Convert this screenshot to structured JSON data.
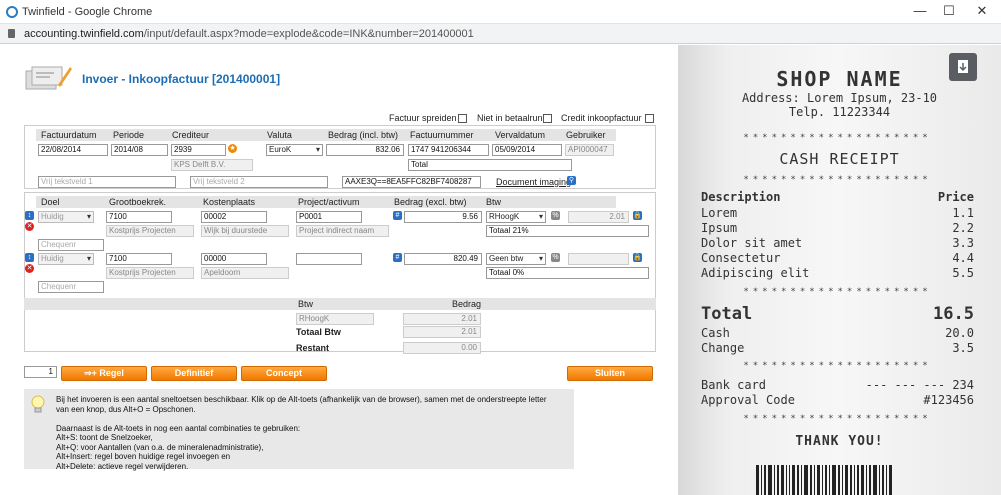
{
  "window": {
    "title": "Twinfield - Google Chrome",
    "url_host": "accounting.twinfield.com",
    "url_path": "/input/default.aspx?mode=explode&code=INK&number=201400001"
  },
  "page": {
    "title": "Invoer - Inkoopfactuur [201400001]"
  },
  "options": {
    "spread": "Factuur spreiden",
    "not_in_payrun": "Niet in betaalrun",
    "credit": "Credit inkoopfactuur"
  },
  "header": {
    "cols": [
      "Factuurdatum",
      "Periode",
      "Crediteur",
      "Valuta",
      "Bedrag (incl. btw)",
      "Factuurnummer",
      "Vervaldatum",
      "Gebruiker"
    ],
    "invoice_date": "22/08/2014",
    "period": "2014/08",
    "creditor": "2939",
    "currency": "EuroK",
    "amount_incl": "832.06",
    "invoice_number": "1747 941206344",
    "due_date": "05/09/2014",
    "user": "API000047",
    "creditor_name": "KPS Delft B.V.",
    "total_label": "Total",
    "free1_placeholder": "Vrij tekstveld 1",
    "free2_placeholder": "Vrij tekstveld 2",
    "doc_code": "AAXE3Q==8EA5FFC82BF7408287",
    "doc_imaging": "Document imaging"
  },
  "lines": {
    "cols": [
      "Doel",
      "Grootboekrek.",
      "Kostenplaats",
      "Project/activum",
      "Bedrag (excl. btw)",
      "Btw"
    ],
    "rows": [
      {
        "goal": "Huidig",
        "ledger": "7100",
        "costcenter": "00002",
        "project": "P0001",
        "amount": "9.56",
        "vat": "RHoogK",
        "vat_amount": "2.01",
        "ledger_name": "Kostprijs Projecten",
        "costcenter_name": "Wijk bij duurstede",
        "project_name": "Project indirect naam",
        "vat_desc": "Totaal 21%",
        "cheque_placeholder": "Chequenr"
      },
      {
        "goal": "Huidig",
        "ledger": "7100",
        "costcenter": "00000",
        "project": "",
        "amount": "820.49",
        "vat": "Geen btw",
        "vat_amount": "",
        "ledger_name": "Kostprijs Projecten",
        "costcenter_name": "Apeldoorn",
        "project_name": "",
        "vat_desc": "Totaal 0%",
        "cheque_placeholder": "Chequenr"
      }
    ]
  },
  "vat_summary": {
    "col_btw": "Btw",
    "col_amount": "Bedrag",
    "code": "RHoogK",
    "code_amount": "2.01",
    "total_label": "Totaal Btw",
    "total_amount": "2.01",
    "rest_label": "Restant",
    "rest_amount": "0.00"
  },
  "actions": {
    "line_count": "1",
    "add_line": "⇒+ Regel",
    "final": "Definitief",
    "concept": "Concept",
    "close": "Sluiten"
  },
  "help": {
    "lines": [
      "Bij het invoeren is een aantal sneltoetsen beschikbaar. Klik op de Alt-toets (afhankelijk van de browser), samen met de onderstreepte letter",
      "van een knop, dus Alt+O = Opschonen.",
      "",
      "Daarnaast is de Alt-toets in nog een aantal combinaties te gebruiken:",
      "Alt+S: toont de Snelzoeker,",
      "Alt+Q: voor Aantallen (van o.a. de mineralenadministratie),",
      "Alt+Insert: regel boven huidige regel invoegen en",
      "Alt+Delete: actieve regel verwijderen."
    ]
  },
  "receipt": {
    "shop": "SHOP NAME",
    "address": "Address: Lorem Ipsum, 23-10",
    "phone": "Telp. 11223344",
    "stars": "********************",
    "heading": "CASH RECEIPT",
    "desc_label": "Description",
    "price_label": "Price",
    "items": [
      {
        "name": "Lorem",
        "price": "1.1"
      },
      {
        "name": "Ipsum",
        "price": "2.2"
      },
      {
        "name": "Dolor sit amet",
        "price": "3.3"
      },
      {
        "name": "Consectetur",
        "price": "4.4"
      },
      {
        "name": "Adipiscing elit",
        "price": "5.5"
      }
    ],
    "total_label": "Total",
    "total": "16.5",
    "cash_label": "Cash",
    "cash": "20.0",
    "change_label": "Change",
    "change": "3.5",
    "bank_label": "Bank card",
    "bank": "--- --- --- 234",
    "approval_label": "Approval Code",
    "approval": "#123456",
    "thanks": "THANK YOU!"
  },
  "colors": {
    "accent": "#1e6cb3",
    "button": "#f07800"
  }
}
